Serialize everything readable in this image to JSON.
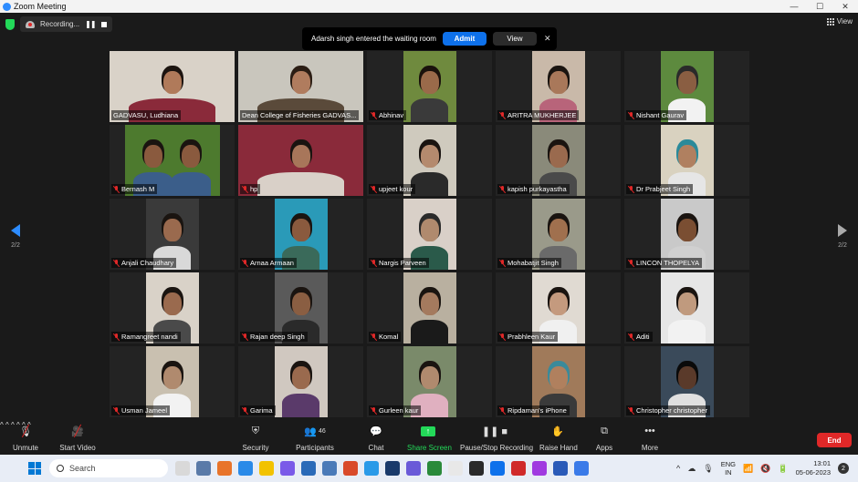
{
  "window": {
    "title": "Zoom Meeting",
    "controls": [
      "—",
      "☐",
      "✕"
    ]
  },
  "recording": {
    "label": "Recording..."
  },
  "view_button": {
    "label": "View"
  },
  "notification": {
    "message": "Adarsh singh entered the waiting room",
    "admit_label": "Admit",
    "view_label": "View",
    "close_label": "✕"
  },
  "pager": {
    "left_label": "2/2",
    "right_label": "2/2"
  },
  "participants": [
    {
      "name": "GADVASU, Ludhiana",
      "muted": false,
      "bg": "#d9d2c8",
      "skin": "#b07a5a",
      "hair": "#1c1410",
      "shirt": "#8a2a3a"
    },
    {
      "name": "Dean College of Fisheries GADVAS...",
      "muted": false,
      "bg": "#c9c6bd",
      "skin": "#b07c5e",
      "hair": "#2b1d14",
      "shirt": "#5a4a3a"
    },
    {
      "name": "Abhinav",
      "muted": true,
      "bg": "#6f8a3e",
      "skin": "#9a6a4a",
      "hair": "#1a120c",
      "shirt": "#3a3a3a"
    },
    {
      "name": "ARITRA MUKHERJEE",
      "muted": true,
      "bg": "#c9b9a9",
      "skin": "#a9785a",
      "hair": "#1a1410",
      "shirt": "#b8647a"
    },
    {
      "name": "Nishant Gaurav",
      "muted": true,
      "bg": "#5d8a3e",
      "skin": "#8a5e42",
      "hair": "#2a2a2a",
      "shirt": "#f2f2f2"
    },
    {
      "name": "Bernash M",
      "muted": true,
      "bg": "#4d7a2e",
      "skin": "#8a5a3e",
      "hair": "#1a1410",
      "shirt": "#3b5e8a"
    },
    {
      "name": "hp",
      "muted": true,
      "bg": "#8a2a3a",
      "skin": "#a8765a",
      "hair": "#1a1410",
      "shirt": "#d9d0c8"
    },
    {
      "name": "upjeet kour",
      "muted": true,
      "bg": "#cfcabe",
      "skin": "#b48a6e",
      "hair": "#1a1410",
      "shirt": "#2a2a2a"
    },
    {
      "name": "kapish purkayastha",
      "muted": true,
      "bg": "#8a8a7a",
      "skin": "#9a6a4e",
      "hair": "#1a1410",
      "shirt": "#4a4a4a"
    },
    {
      "name": "Dr Prabjeet Singh",
      "muted": true,
      "bg": "#d9d2c0",
      "skin": "#b08060",
      "hair": "#2a8a9a",
      "shirt": "#e6e6e6"
    },
    {
      "name": "Anjali Chaudhary",
      "muted": true,
      "bg": "#3a3a3a",
      "skin": "#9a6a4e",
      "hair": "#1a1410",
      "shirt": "#d9d9d9"
    },
    {
      "name": "Arnaa Armaan",
      "muted": true,
      "bg": "#2a9ab8",
      "skin": "#8a5a3e",
      "hair": "#1a1410",
      "shirt": "#3a6a5a"
    },
    {
      "name": "Nargis Parveen",
      "muted": true,
      "bg": "#d9d0c8",
      "skin": "#b08a6e",
      "hair": "#2a2a2a",
      "shirt": "#2a5a4a"
    },
    {
      "name": "Mohabatjit Singh",
      "muted": true,
      "bg": "#9a9a8a",
      "skin": "#a0704e",
      "hair": "#1a1410",
      "shirt": "#6a6a6a"
    },
    {
      "name": "LINCON THOPELYA",
      "muted": true,
      "bg": "#c9c9c9",
      "skin": "#7a4e32",
      "hair": "#1a1410",
      "shirt": "#d0d0d0"
    },
    {
      "name": "Ramangreet nandi",
      "muted": true,
      "bg": "#d9d2c8",
      "skin": "#9a6a4e",
      "hair": "#1a1410",
      "shirt": "#4a4a4a"
    },
    {
      "name": "Rajan deep Singh",
      "muted": true,
      "bg": "#5a5a5a",
      "skin": "#8a5e42",
      "hair": "#1a1410",
      "shirt": "#2a2a2a"
    },
    {
      "name": "Komal",
      "muted": true,
      "bg": "#b9b0a0",
      "skin": "#a47a5e",
      "hair": "#1a1410",
      "shirt": "#1a1a1a"
    },
    {
      "name": "Prabhleen Kaur",
      "muted": true,
      "bg": "#e0dad2",
      "skin": "#c49a7e",
      "hair": "#1a1410",
      "shirt": "#f0f0f0"
    },
    {
      "name": "Aditi",
      "muted": true,
      "bg": "#e6e6e6",
      "skin": "#c09a7e",
      "hair": "#1a1410",
      "shirt": "#f2f2f2"
    },
    {
      "name": "Usman Jameel",
      "muted": true,
      "bg": "#c9c0b0",
      "skin": "#b08a6e",
      "hair": "#1a1410",
      "shirt": "#f2f2f2"
    },
    {
      "name": "Garima",
      "muted": true,
      "bg": "#d0c8c0",
      "skin": "#9a6a4e",
      "hair": "#1a1410",
      "shirt": "#5a3a6a"
    },
    {
      "name": "Gurleen kaur",
      "muted": true,
      "bg": "#7a8a6a",
      "skin": "#b08a6e",
      "hair": "#1a1410",
      "shirt": "#e0b0c0"
    },
    {
      "name": "Ripdaman's iPhone",
      "muted": true,
      "bg": "#a07a5a",
      "skin": "#b0805e",
      "hair": "#3a8a9a",
      "shirt": "#3a3a3a"
    },
    {
      "name": "Christopher christopher",
      "muted": true,
      "bg": "#3a4a5a",
      "skin": "#5a3a2a",
      "hair": "#0a0a0a",
      "shirt": "#e0e0e0"
    }
  ],
  "toolbar": {
    "unmute": "Unmute",
    "start_video": "Start Video",
    "security": "Security",
    "participants": "Participants",
    "participants_count": "46",
    "chat": "Chat",
    "share_screen": "Share Screen",
    "pause_recording": "Pause/Stop Recording",
    "raise_hand": "Raise Hand",
    "apps": "Apps",
    "more": "More",
    "end": "End"
  },
  "taskbar": {
    "search_placeholder": "Search",
    "language_top": "ENG",
    "language_bottom": "IN",
    "time": "13:01",
    "date": "05-06-2023",
    "notification_count": "2",
    "app_colors": [
      "#d9d9d9",
      "#5a7aa8",
      "#e8742a",
      "#2a8ae8",
      "#f2c200",
      "#7a5ae8",
      "#2a6ab8",
      "#4a7ab8",
      "#d94a2a",
      "#2a9ae8",
      "#1a3a6a",
      "#6a5ad8",
      "#2a8a3a",
      "#e8e8e8",
      "#2a2a2a",
      "#0e71eb",
      "#d02a2a",
      "#a03ae0",
      "#2a5ab8",
      "#3a7ae8"
    ]
  }
}
